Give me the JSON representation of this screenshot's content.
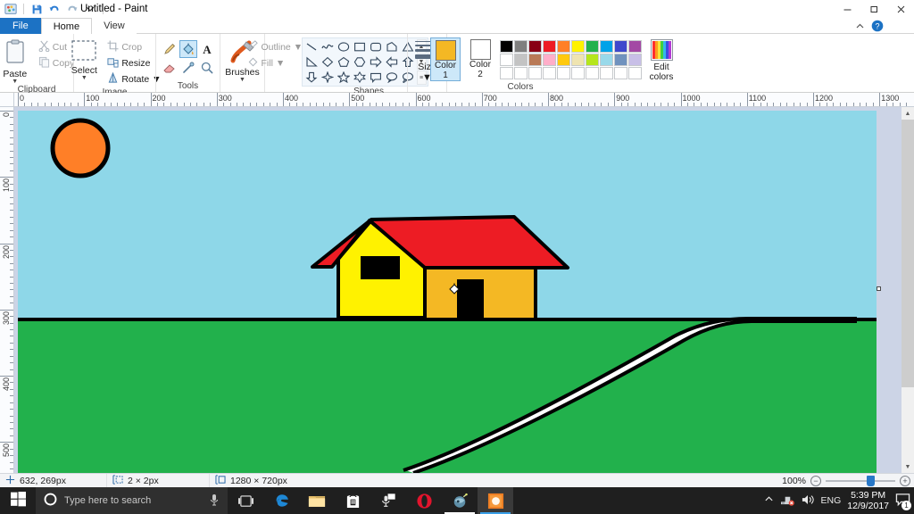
{
  "window": {
    "title": "Untitled - Paint",
    "quick_access": [
      {
        "name": "paint-app-icon",
        "glyph": "paint"
      },
      {
        "name": "save-icon",
        "glyph": "save"
      },
      {
        "name": "undo-icon",
        "glyph": "undo"
      },
      {
        "name": "redo-icon",
        "glyph": "redo"
      },
      {
        "name": "customize-qat-icon",
        "glyph": "caret-down"
      }
    ],
    "controls": {
      "minimize": "—",
      "maximize": "❐",
      "close": "✕",
      "collapse_ribbon": "⌃",
      "help": "?"
    }
  },
  "tabs": [
    {
      "label": "File",
      "state": "file"
    },
    {
      "label": "Home",
      "state": "active"
    },
    {
      "label": "View",
      "state": "inactive"
    }
  ],
  "ribbon": {
    "groups": [
      {
        "name": "clipboard",
        "label": "Clipboard",
        "big_button": {
          "label": "Paste",
          "icon": "clipboard-icon",
          "has_caret": true
        },
        "small_buttons": [
          {
            "label": "Cut",
            "icon": "scissors-icon",
            "enabled": false
          },
          {
            "label": "Copy",
            "icon": "copy-icon",
            "enabled": false
          }
        ]
      },
      {
        "name": "image",
        "label": "Image",
        "big_button": {
          "label": "Select",
          "icon": "selection-dashed-icon",
          "has_caret": true
        },
        "small_buttons": [
          {
            "label": "Crop",
            "icon": "crop-icon",
            "enabled": false
          },
          {
            "label": "Resize",
            "icon": "resize-icon",
            "enabled": true
          },
          {
            "label": "Rotate",
            "icon": "rotate-icon",
            "enabled": true,
            "has_caret": true
          }
        ]
      },
      {
        "name": "tools",
        "label": "Tools",
        "tools": [
          {
            "name": "pencil-tool",
            "selected": false
          },
          {
            "name": "fill-with-color-tool",
            "selected": true
          },
          {
            "name": "text-tool",
            "selected": false
          },
          {
            "name": "eraser-tool",
            "selected": false
          },
          {
            "name": "color-picker-tool",
            "selected": false
          },
          {
            "name": "magnifier-tool",
            "selected": false
          }
        ]
      },
      {
        "name": "brushes",
        "label": "",
        "big_button": {
          "label": "Brushes",
          "icon": "brush-icon",
          "has_caret": true
        }
      },
      {
        "name": "shapes",
        "label": "Shapes",
        "shapes": [
          "line",
          "curve",
          "oval",
          "rectangle",
          "rounded-rectangle",
          "polygon",
          "triangle",
          "right-triangle",
          "diamond",
          "pentagon",
          "hexagon",
          "arrow-right",
          "arrow-left",
          "arrow-up",
          "arrow-down",
          "four-point-star",
          "five-point-star",
          "six-point-star",
          "rounded-callout",
          "oval-callout",
          "cloud-callout"
        ],
        "scroll": {
          "up": "▲",
          "down": "▼",
          "more": "≡"
        },
        "outline": {
          "label": "Outline",
          "icon": "outline-icon",
          "has_caret": true
        },
        "fill": {
          "label": "Fill",
          "icon": "fill-icon",
          "has_caret": true
        }
      },
      {
        "name": "size",
        "label": "",
        "big_button": {
          "label": "Size",
          "icon": "size-lines-icon",
          "has_caret": true
        }
      },
      {
        "name": "colors",
        "label": "Colors",
        "color1": {
          "label_line1": "Color",
          "label_line2": "1",
          "value": "#f4b824",
          "selected": true
        },
        "color2": {
          "label_line1": "Color",
          "label_line2": "2",
          "value": "#ffffff",
          "selected": false
        },
        "palette_row1": [
          "#000000",
          "#7f7f7f",
          "#880015",
          "#ed1c24",
          "#ff7f27",
          "#fff200",
          "#22b14c",
          "#00a2e8",
          "#3f48cc",
          "#a349a4"
        ],
        "palette_row2": [
          "#ffffff",
          "#c3c3c3",
          "#b97a57",
          "#ffaec9",
          "#ffc90e",
          "#efe4b0",
          "#b5e61d",
          "#99d9ea",
          "#7092be",
          "#c8bfe7"
        ],
        "palette_row3": [
          "#ffffff",
          "#ffffff",
          "#ffffff",
          "#ffffff",
          "#ffffff",
          "#ffffff",
          "#ffffff",
          "#ffffff",
          "#ffffff",
          "#ffffff"
        ],
        "edit_colors": {
          "label_line1": "Edit",
          "label_line2": "colors",
          "icon": "color-spectrum-icon"
        }
      }
    ]
  },
  "rulers": {
    "horizontal_labels": [
      "0",
      "100",
      "200",
      "300",
      "400",
      "500",
      "600",
      "700",
      "800",
      "900",
      "1000",
      "1100",
      "1200",
      "1300"
    ],
    "vertical_labels": [
      "0",
      "100",
      "200",
      "300",
      "400",
      "500"
    ],
    "unit": "px"
  },
  "canvas": {
    "sky_color": "#8ed7e8",
    "grass_color": "#22b14c",
    "sun_color": "#ff7f27",
    "roof_color": "#ed1c24",
    "wall_front_color": "#fff200",
    "wall_side_color": "#f4b824",
    "window_color": "#000000",
    "door_color": "#000000",
    "path_color": "#ffffff",
    "outline_color": "#000000",
    "cursor": "fill-bucket-cursor"
  },
  "statusbar": {
    "cursor_position": "632, 269px",
    "selection_size": "2 × 2px",
    "image_size": "1280 × 720px",
    "cursor_icon": "crosshair-icon",
    "selection_icon": "selection-size-icon",
    "image_icon": "image-size-icon",
    "zoom_level": "100%",
    "zoom_out": "−",
    "zoom_in": "+"
  },
  "taskbar": {
    "start": {
      "name": "start-button",
      "icon": "windows-logo-icon"
    },
    "search": {
      "placeholder": "Type here to search",
      "icon": "cortana-circle-icon",
      "mic": "microphone-icon"
    },
    "items": [
      {
        "name": "task-view-button",
        "icon": "task-view-icon",
        "state": "idle"
      },
      {
        "name": "microsoft-edge-button",
        "icon": "edge-icon",
        "state": "idle"
      },
      {
        "name": "file-explorer-button",
        "icon": "folder-icon",
        "state": "idle"
      },
      {
        "name": "microsoft-store-button",
        "icon": "store-icon",
        "state": "idle"
      },
      {
        "name": "snipping-tool-button",
        "icon": "snip-icon",
        "state": "idle"
      },
      {
        "name": "opera-browser-button",
        "icon": "opera-icon",
        "state": "idle"
      },
      {
        "name": "browser-app-button",
        "icon": "globe-icon",
        "state": "running"
      },
      {
        "name": "paint-taskbar-button",
        "icon": "paint-icon",
        "state": "active"
      }
    ],
    "tray": {
      "chevron": "⌃",
      "network": "network-icon",
      "volume": "volume-icon",
      "language": "ENG",
      "time": "5:39 PM",
      "date": "12/9/2017",
      "notifications": {
        "icon": "action-center-icon",
        "badge": "1"
      }
    }
  }
}
